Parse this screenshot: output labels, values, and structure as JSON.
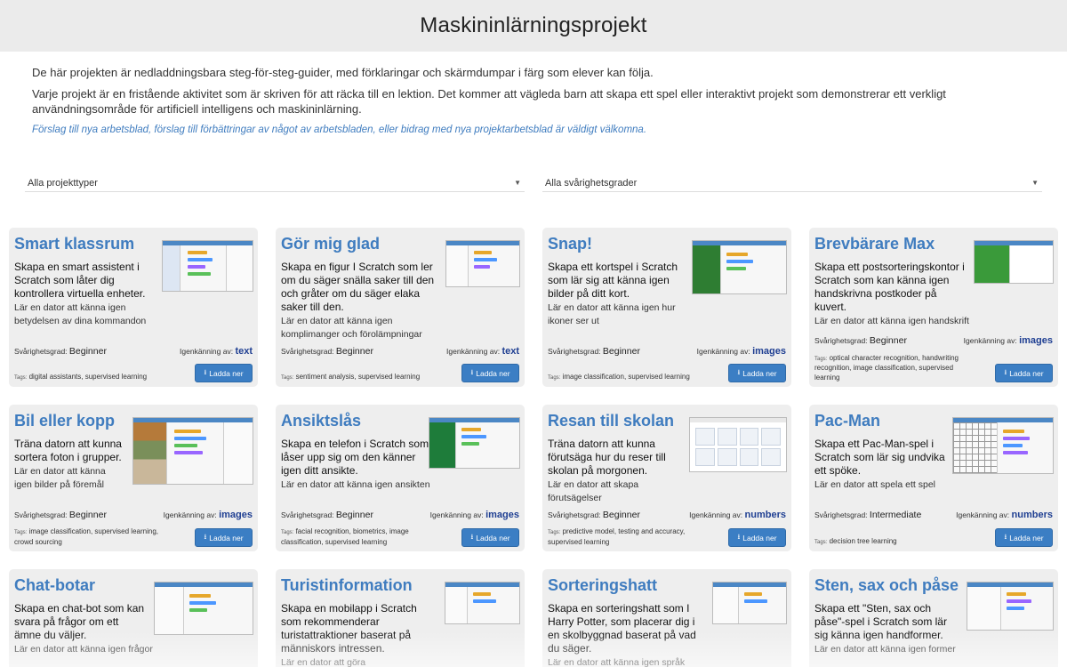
{
  "page": {
    "title": "Maskininlärningsprojekt",
    "intro1": "De här projekten är nedladdningsbara steg-för-steg-guider, med förklaringar och skärmdumpar i färg som elever kan följa.",
    "intro2": "Varje projekt är en fristående aktivitet som är skriven för att räcka till en lektion. Det kommer att vägleda barn att skapa ett spel eller interaktivt projekt som demonstrerar ett verkligt användningsområde för artificiell intelligens och maskininlärning.",
    "contrib": "Förslag till nya arbetsblad, förslag till förbättringar av något av arbetsbladen, eller bidrag med nya projektarbetsblad är väldigt välkomna."
  },
  "filters": {
    "type": "Alla projekttyper",
    "difficulty": "Alla svårighetsgrader"
  },
  "labels": {
    "difficulty": "Svårighetsgrad:",
    "recognition": "Igenkänning av:",
    "tags": "Tags:",
    "download": "Ladda ner"
  },
  "icons": {
    "caret": "caret-down-icon",
    "download": "download-icon"
  },
  "colors": {
    "title": "#3f7cbf",
    "button": "#3b7ec4",
    "card": "#eeeeee",
    "recognition": "#1f3f92"
  },
  "projects": [
    {
      "title": "Smart klassrum",
      "desc": "Skapa en smart assistent i Scratch som låter dig kontrollera virtuella enheter.",
      "learn": "Lär en dator att känna igen betydelsen av dina kommandon",
      "level": "Beginner",
      "recognition": "text",
      "tags": "digital assistants, supervised learning"
    },
    {
      "title": "Gör mig glad",
      "desc": "Skapa en figur I Scratch som ler om du säger snälla saker till den och gråter om du säger elaka saker till den.",
      "learn": "Lär en dator att känna igen komplimanger och förolämpningar",
      "level": "Beginner",
      "recognition": "text",
      "tags": "sentiment analysis, supervised learning"
    },
    {
      "title": "Snap!",
      "desc": "Skapa ett kortspel i Scratch som lär sig att känna igen bilder på ditt kort.",
      "learn": "Lär en dator att känna igen hur ikoner ser ut",
      "level": "Beginner",
      "recognition": "images",
      "tags": "image classification, supervised learning"
    },
    {
      "title": "Brevbärare Max",
      "desc": "Skapa ett postsorteringskontor i Scratch som kan känna igen handskrivna postkoder på kuvert.",
      "learn": "Lär en dator att känna igen handskrift",
      "level": "Beginner",
      "recognition": "images",
      "tags": "optical character recognition, handwriting recognition, image classification, supervised learning"
    },
    {
      "title": "Bil eller kopp",
      "desc": "Träna datorn att kunna sortera foton i grupper.",
      "learn": "Lär en dator att känna igen bilder på föremål",
      "level": "Beginner",
      "recognition": "images",
      "tags": "image classification, supervised learning, crowd sourcing"
    },
    {
      "title": "Ansiktslås",
      "desc": "Skapa en telefon i Scratch som låser upp sig om den känner igen ditt ansikte.",
      "learn": "Lär en dator att känna igen ansikten",
      "level": "Beginner",
      "recognition": "images",
      "tags": "facial recognition, biometrics, image classification, supervised learning"
    },
    {
      "title": "Resan till skolan",
      "desc": "Träna datorn att kunna förutsäga hur du reser till skolan på morgonen.",
      "learn": "Lär en dator att skapa förutsägelser",
      "level": "Beginner",
      "recognition": "numbers",
      "tags": "predictive model, testing and accuracy, supervised learning"
    },
    {
      "title": "Pac-Man",
      "desc": "Skapa ett Pac-Man-spel i Scratch som lär sig undvika ett spöke.",
      "learn": "Lär en dator att spela ett spel",
      "level": "Intermediate",
      "recognition": "numbers",
      "tags": "decision tree learning"
    },
    {
      "title": "Chat-botar",
      "desc": "Skapa en chat-bot som kan svara på frågor om ett ämne du väljer.",
      "learn": "Lär en dator att känna igen frågor"
    },
    {
      "title": "Turistinformation",
      "desc": "Skapa en mobilapp i Scratch som rekommenderar turistattraktioner baserat på människors intressen.",
      "learn": "Lär en dator att göra rekommendationer"
    },
    {
      "title": "Sorteringshatt",
      "desc": "Skapa en sorteringshatt som I Harry Potter, som placerar dig i en skolbyggnad baserat på vad du säger.",
      "learn": "Lär en dator att känna igen språk"
    },
    {
      "title": "Sten, sax och påse",
      "desc": "Skapa ett \"Sten, sax och påse\"-spel i Scratch som lär sig känna igen handformer.",
      "learn": "Lär en dator att känna igen former"
    }
  ]
}
